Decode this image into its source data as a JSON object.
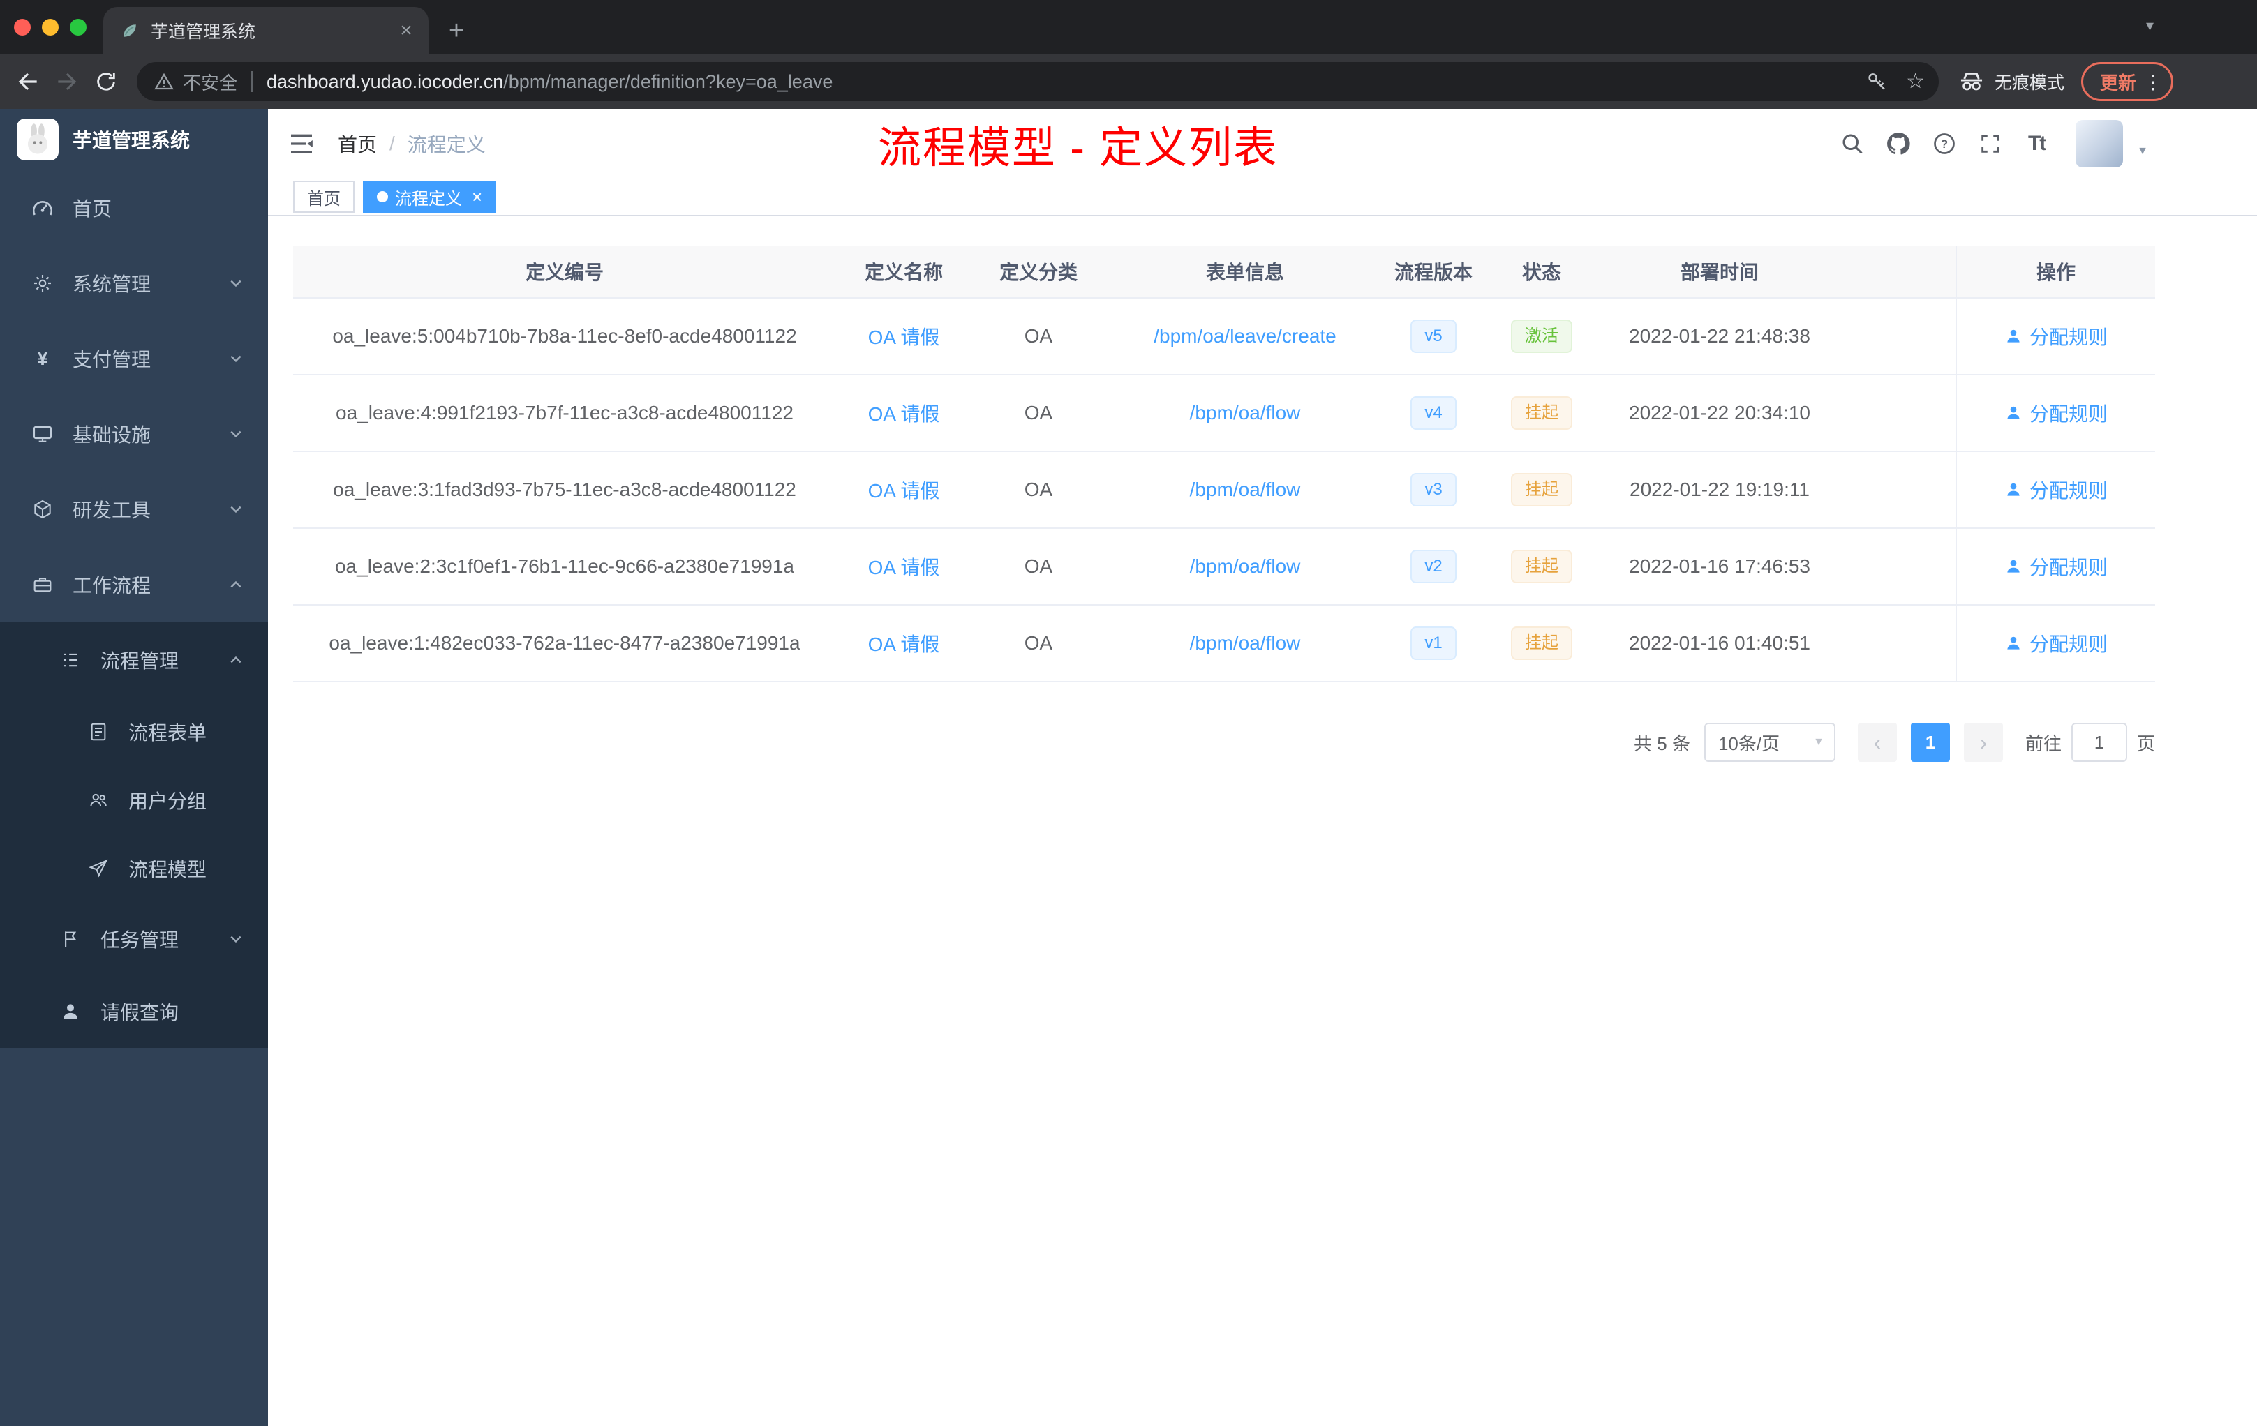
{
  "browser": {
    "tab_title": "芋道管理系统",
    "security_label": "不安全",
    "url_host": "dashboard.yudao.iocoder.cn",
    "url_path": "/bpm/manager/definition?key=oa_leave",
    "incognito_label": "无痕模式",
    "update_label": "更新"
  },
  "sidebar": {
    "logo_title": "芋道管理系统",
    "menu": [
      {
        "label": "首页"
      },
      {
        "label": "系统管理"
      },
      {
        "label": "支付管理"
      },
      {
        "label": "基础设施"
      },
      {
        "label": "研发工具"
      },
      {
        "label": "工作流程"
      },
      {
        "label": "流程管理"
      },
      {
        "label": "流程表单"
      },
      {
        "label": "用户分组"
      },
      {
        "label": "流程模型"
      },
      {
        "label": "任务管理"
      },
      {
        "label": "请假查询"
      }
    ]
  },
  "header": {
    "breadcrumb_home": "首页",
    "breadcrumb_separator": "/",
    "breadcrumb_current": "流程定义",
    "annotation": "流程模型 - 定义列表"
  },
  "tags": {
    "home": "首页",
    "current": "流程定义"
  },
  "table": {
    "columns": [
      "定义编号",
      "定义名称",
      "定义分类",
      "表单信息",
      "流程版本",
      "状态",
      "部署时间",
      "操作"
    ],
    "rows": [
      {
        "id": "oa_leave:5:004b710b-7b8a-11ec-8ef0-acde48001122",
        "name": "OA 请假",
        "category": "OA",
        "form": "/bpm/oa/leave/create",
        "version": "v5",
        "status": "激活",
        "time": "2022-01-22 21:48:38",
        "action": "分配规则"
      },
      {
        "id": "oa_leave:4:991f2193-7b7f-11ec-a3c8-acde48001122",
        "name": "OA 请假",
        "category": "OA",
        "form": "/bpm/oa/flow",
        "version": "v4",
        "status": "挂起",
        "time": "2022-01-22 20:34:10",
        "action": "分配规则"
      },
      {
        "id": "oa_leave:3:1fad3d93-7b75-11ec-a3c8-acde48001122",
        "name": "OA 请假",
        "category": "OA",
        "form": "/bpm/oa/flow",
        "version": "v3",
        "status": "挂起",
        "time": "2022-01-22 19:19:11",
        "action": "分配规则"
      },
      {
        "id": "oa_leave:2:3c1f0ef1-76b1-11ec-9c66-a2380e71991a",
        "name": "OA 请假",
        "category": "OA",
        "form": "/bpm/oa/flow",
        "version": "v2",
        "status": "挂起",
        "time": "2022-01-16 17:46:53",
        "action": "分配规则"
      },
      {
        "id": "oa_leave:1:482ec033-762a-11ec-8477-a2380e71991a",
        "name": "OA 请假",
        "category": "OA",
        "form": "/bpm/oa/flow",
        "version": "v1",
        "status": "挂起",
        "time": "2022-01-16 01:40:51",
        "action": "分配规则"
      }
    ]
  },
  "pagination": {
    "total": "共 5 条",
    "page_size": "10条/页",
    "current_page": "1",
    "goto_label": "前往",
    "goto_value": "1",
    "page_unit": "页"
  },
  "icons": {
    "new_tab": "+",
    "tab_close": "×",
    "tab_search_caret": "▾",
    "star": "☆",
    "kebab": "⋮",
    "yen": "¥",
    "question": "?",
    "font_size": "Tt",
    "avatar_caret": "▼",
    "tag_close": "×",
    "select_caret": "▼",
    "prev": "‹",
    "next": "›"
  },
  "colors": {
    "accent": "#409eff",
    "success": "#67c23a",
    "warning": "#e6a23c",
    "annotation_red": "#fe0000",
    "sidebar_bg": "#304156",
    "submenu_bg": "#1f2d3d"
  }
}
